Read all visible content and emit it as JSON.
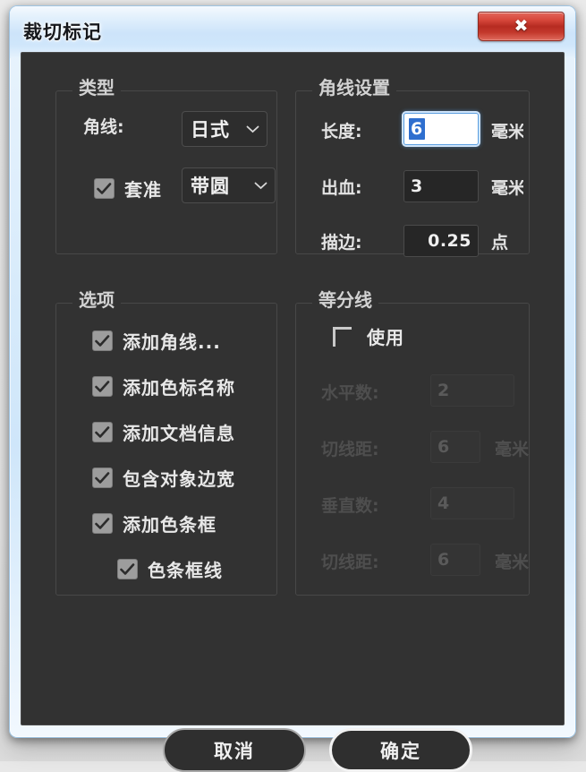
{
  "window": {
    "title": "裁切标记",
    "close_glyph": "✖",
    "close_icon": "close-icon"
  },
  "type_group": {
    "title": "类型",
    "corner_label": "角线:",
    "corner_value": "日式",
    "registration_checked": true,
    "registration_label": "套准",
    "registration_value": "带圆",
    "chevron_icon": "chevron-down-icon"
  },
  "corner_settings_group": {
    "title": "角线设置",
    "rows": [
      {
        "label": "长度:",
        "value": "6",
        "unit": "毫米",
        "focused": true,
        "disabled": false
      },
      {
        "label": "出血:",
        "value": "3",
        "unit": "毫米",
        "focused": false,
        "disabled": false
      },
      {
        "label": "描边:",
        "value": "0.25",
        "unit": "点",
        "focused": false,
        "disabled": false
      }
    ]
  },
  "options_group": {
    "title": "选项",
    "items": [
      {
        "label": "添加角线...",
        "checked": true,
        "indented": false
      },
      {
        "label": "添加色标名称",
        "checked": true,
        "indented": false
      },
      {
        "label": "添加文档信息",
        "checked": true,
        "indented": false
      },
      {
        "label": "包含对象边宽",
        "checked": true,
        "indented": false
      },
      {
        "label": "添加色条框",
        "checked": true,
        "indented": false
      },
      {
        "label": "色条框线",
        "checked": true,
        "indented": true
      }
    ]
  },
  "division_group": {
    "title": "等分线",
    "use_label": "使用",
    "use_checked": false,
    "rows": [
      {
        "label": "水平数:",
        "value": "2",
        "unit": ""
      },
      {
        "label": "切线距:",
        "value": "6",
        "unit": "毫米"
      },
      {
        "label": "垂直数:",
        "value": "4",
        "unit": ""
      },
      {
        "label": "切线距:",
        "value": "6",
        "unit": "毫米"
      }
    ]
  },
  "buttons": {
    "cancel": "取消",
    "ok": "确定"
  },
  "colors": {
    "dialog_bg": "#323232",
    "frame_blue": "#cfe6fa",
    "close_red": "#b62b21",
    "focus_blue": "#2f6fcf",
    "text": "#e8e8e8"
  }
}
